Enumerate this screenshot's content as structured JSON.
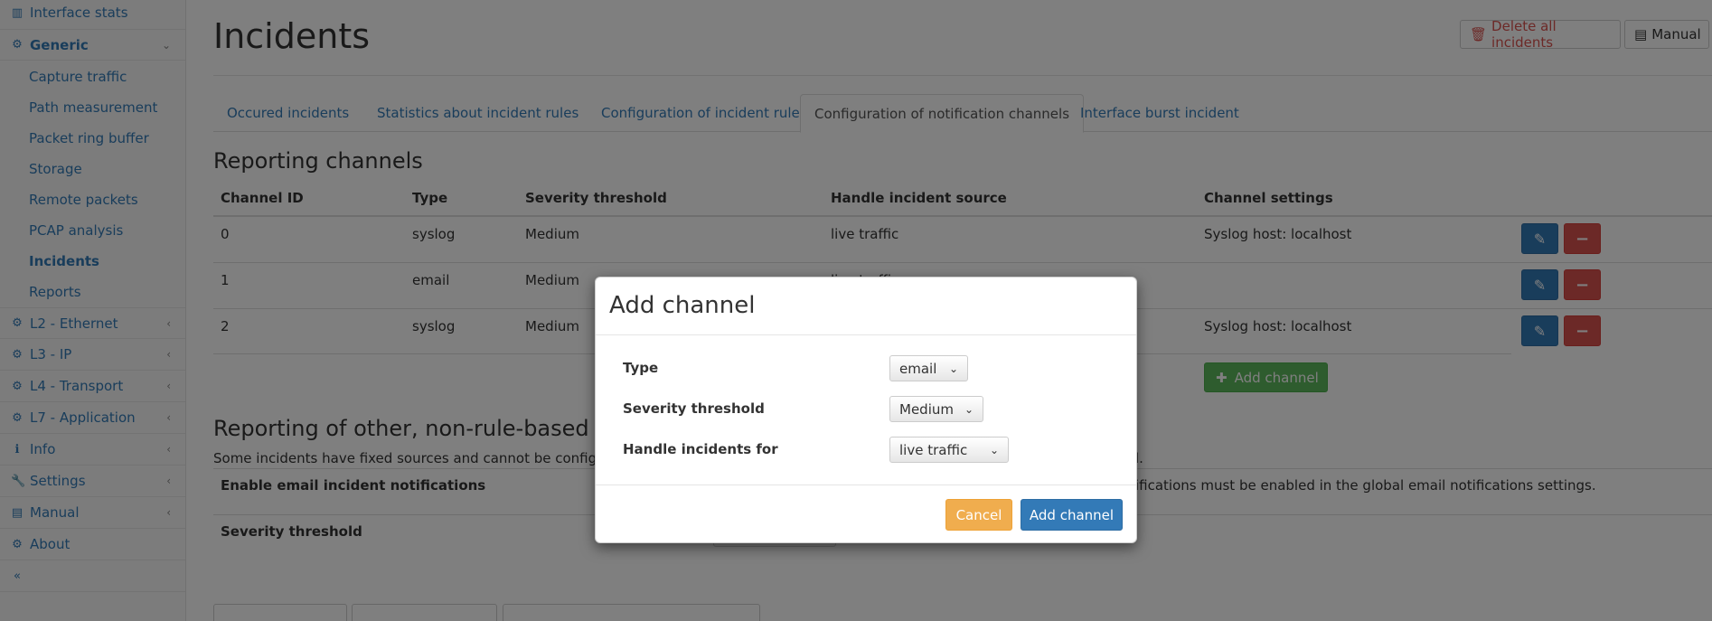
{
  "sidebar": {
    "interface_stats": "Interface stats",
    "generic": "Generic",
    "generic_items": [
      "Capture traffic",
      "Path measurement",
      "Packet ring buffer",
      "Storage",
      "Remote packets",
      "PCAP analysis",
      "Incidents",
      "Reports"
    ],
    "sections": [
      "L2 - Ethernet",
      "L3 - IP",
      "L4 - Transport",
      "L7 - Application",
      "Info",
      "Settings",
      "Manual",
      "About"
    ],
    "collapse": "«"
  },
  "header": {
    "title": "Incidents",
    "delete_all": "Delete all incidents",
    "manual": "Manual"
  },
  "tabs": [
    "Occured incidents",
    "Statistics about incident rules",
    "Configuration of incident rules",
    "Configuration of notification channels",
    "Interface burst incident"
  ],
  "channels": {
    "heading": "Reporting channels",
    "columns": [
      "Channel ID",
      "Type",
      "Severity threshold",
      "Handle incident source",
      "Channel settings"
    ],
    "rows": [
      {
        "id": "0",
        "type": "syslog",
        "severity": "Medium",
        "source": "live traffic",
        "settings": "Syslog host: localhost"
      },
      {
        "id": "1",
        "type": "email",
        "severity": "Medium",
        "source": "live traffic",
        "settings": ""
      },
      {
        "id": "2",
        "type": "syslog",
        "severity": "Medium",
        "source": "",
        "settings": "Syslog host: localhost"
      }
    ],
    "add_label": "Add channel"
  },
  "other": {
    "heading": "Reporting of other, non-rule-based",
    "desc_left": "Some incidents have fixed sources and cannot be configured",
    "desc_right": "l.",
    "enable_email": "Enable email incident notifications",
    "enable_email_note": "ifications must be enabled in the global email notifications settings.",
    "severity": "Severity threshold"
  },
  "modal": {
    "title": "Add channel",
    "type_label": "Type",
    "type_value": "email",
    "severity_label": "Severity threshold",
    "severity_value": "Medium",
    "handle_label": "Handle incidents for",
    "handle_value": "live traffic",
    "cancel": "Cancel",
    "add": "Add channel"
  },
  "colors": {
    "primary": "#337ab7",
    "danger": "#d9534f",
    "success": "#5cb85c",
    "warning": "#f0ad4e"
  }
}
